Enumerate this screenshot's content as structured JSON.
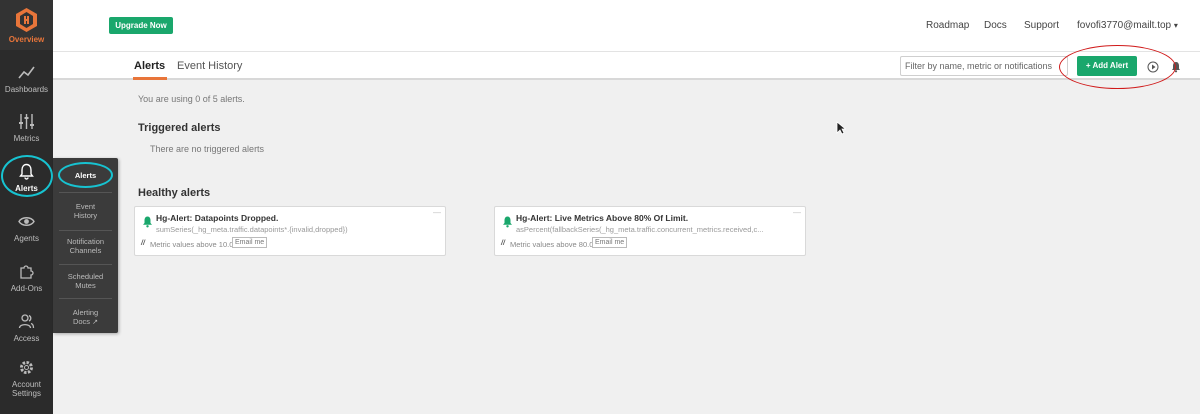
{
  "sidebar": {
    "logo_label": "Overview",
    "items": [
      {
        "label": "Dashboards",
        "icon": "chart-line-icon"
      },
      {
        "label": "Metrics",
        "icon": "sliders-icon"
      },
      {
        "label": "Alerts",
        "icon": "bell-icon"
      },
      {
        "label": "Agents",
        "icon": "eye-icon"
      },
      {
        "label": "Add-Ons",
        "icon": "puzzle-icon"
      },
      {
        "label": "Access",
        "icon": "users-icon"
      },
      {
        "label": "Account Settings",
        "icon": "gear-icon"
      }
    ]
  },
  "flyout": {
    "items": [
      "Alerts",
      "Event History",
      "Notification Channels",
      "Scheduled Mutes",
      "Alerting Docs"
    ]
  },
  "header": {
    "upgrade_label": "Upgrade Now",
    "links": [
      "Roadmap",
      "Docs",
      "Support"
    ],
    "user_email": "fovofi3770@mailt.top"
  },
  "tabs": [
    "Alerts",
    "Event History"
  ],
  "toolbar": {
    "filter_placeholder": "Filter by name, metric or notifications",
    "add_alert_label": "+ Add Alert"
  },
  "main": {
    "usage_text": "You are using 0 of 5 alerts.",
    "triggered_title": "Triggered alerts",
    "triggered_empty": "There are no triggered alerts",
    "healthy_title": "Healthy alerts",
    "cards": [
      {
        "title": "Hg-Alert: Datapoints Dropped.",
        "query": "sumSeries(_hg_meta.traffic.datapoints*.{invalid,dropped})",
        "condition": "Metric values above 10.0",
        "notify": "Email me"
      },
      {
        "title": "Hg-Alert: Live Metrics Above 80% Of Limit.",
        "query": "asPercent(fallbackSeries(_hg_meta.traffic.concurrent_metrics.received,c...",
        "condition": "Metric values above 80.0",
        "notify": "Email me"
      }
    ]
  },
  "colors": {
    "brand_orange": "#e8753a",
    "accent_green": "#1aa76c",
    "sidebar_bg": "#2b2b2b",
    "annotation_red": "#d01a1a",
    "annotation_cyan": "#17c3d1"
  }
}
